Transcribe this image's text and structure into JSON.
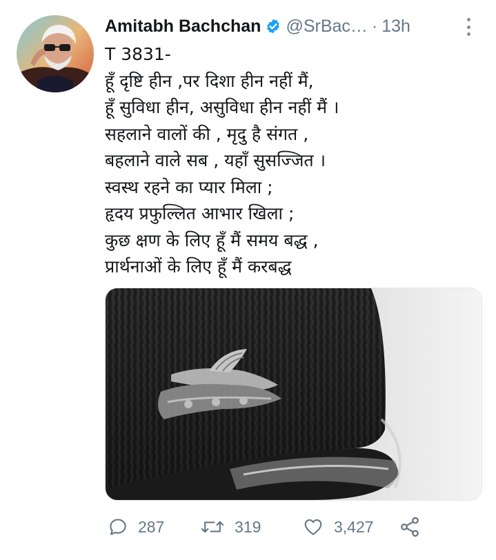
{
  "tweet": {
    "author_name": "Amitabh Bachchan",
    "handle": "@SrBac…",
    "separator": "·",
    "time": "13h",
    "lines": [
      "T 3831-",
      "हूँ दृष्टि हीन ,पर  दिशा हीन नहीं मैं,",
      "हूँ सुविधा हीन, असुविधा हीन नहीं मैं ।",
      "सहलाने वालों की , मृदु है संगत ,",
      "बहलाने वाले सब , यहाँ  सुसज्जित  ।",
      "स्वस्थ रहने का प्यार मिला ;",
      "हृदय प्रफुल्लित आभार खिला  ;",
      "कुछ क्षण के लिए हूँ मैं  समय बद्ध ,",
      "प्रार्थनाओं के लिए हूँ मैं करबद्ध"
    ]
  },
  "actions": {
    "reply_count": "287",
    "retweet_count": "319",
    "like_count": "3,427"
  },
  "icons": {
    "verified": "verified-badge-icon",
    "more": "more-vertical-icon",
    "reply": "reply-icon",
    "retweet": "retweet-icon",
    "like": "heart-icon",
    "share": "share-icon"
  },
  "colors": {
    "verified_blue": "#1da1f2",
    "secondary_text": "#657786",
    "primary_text": "#14171a"
  }
}
